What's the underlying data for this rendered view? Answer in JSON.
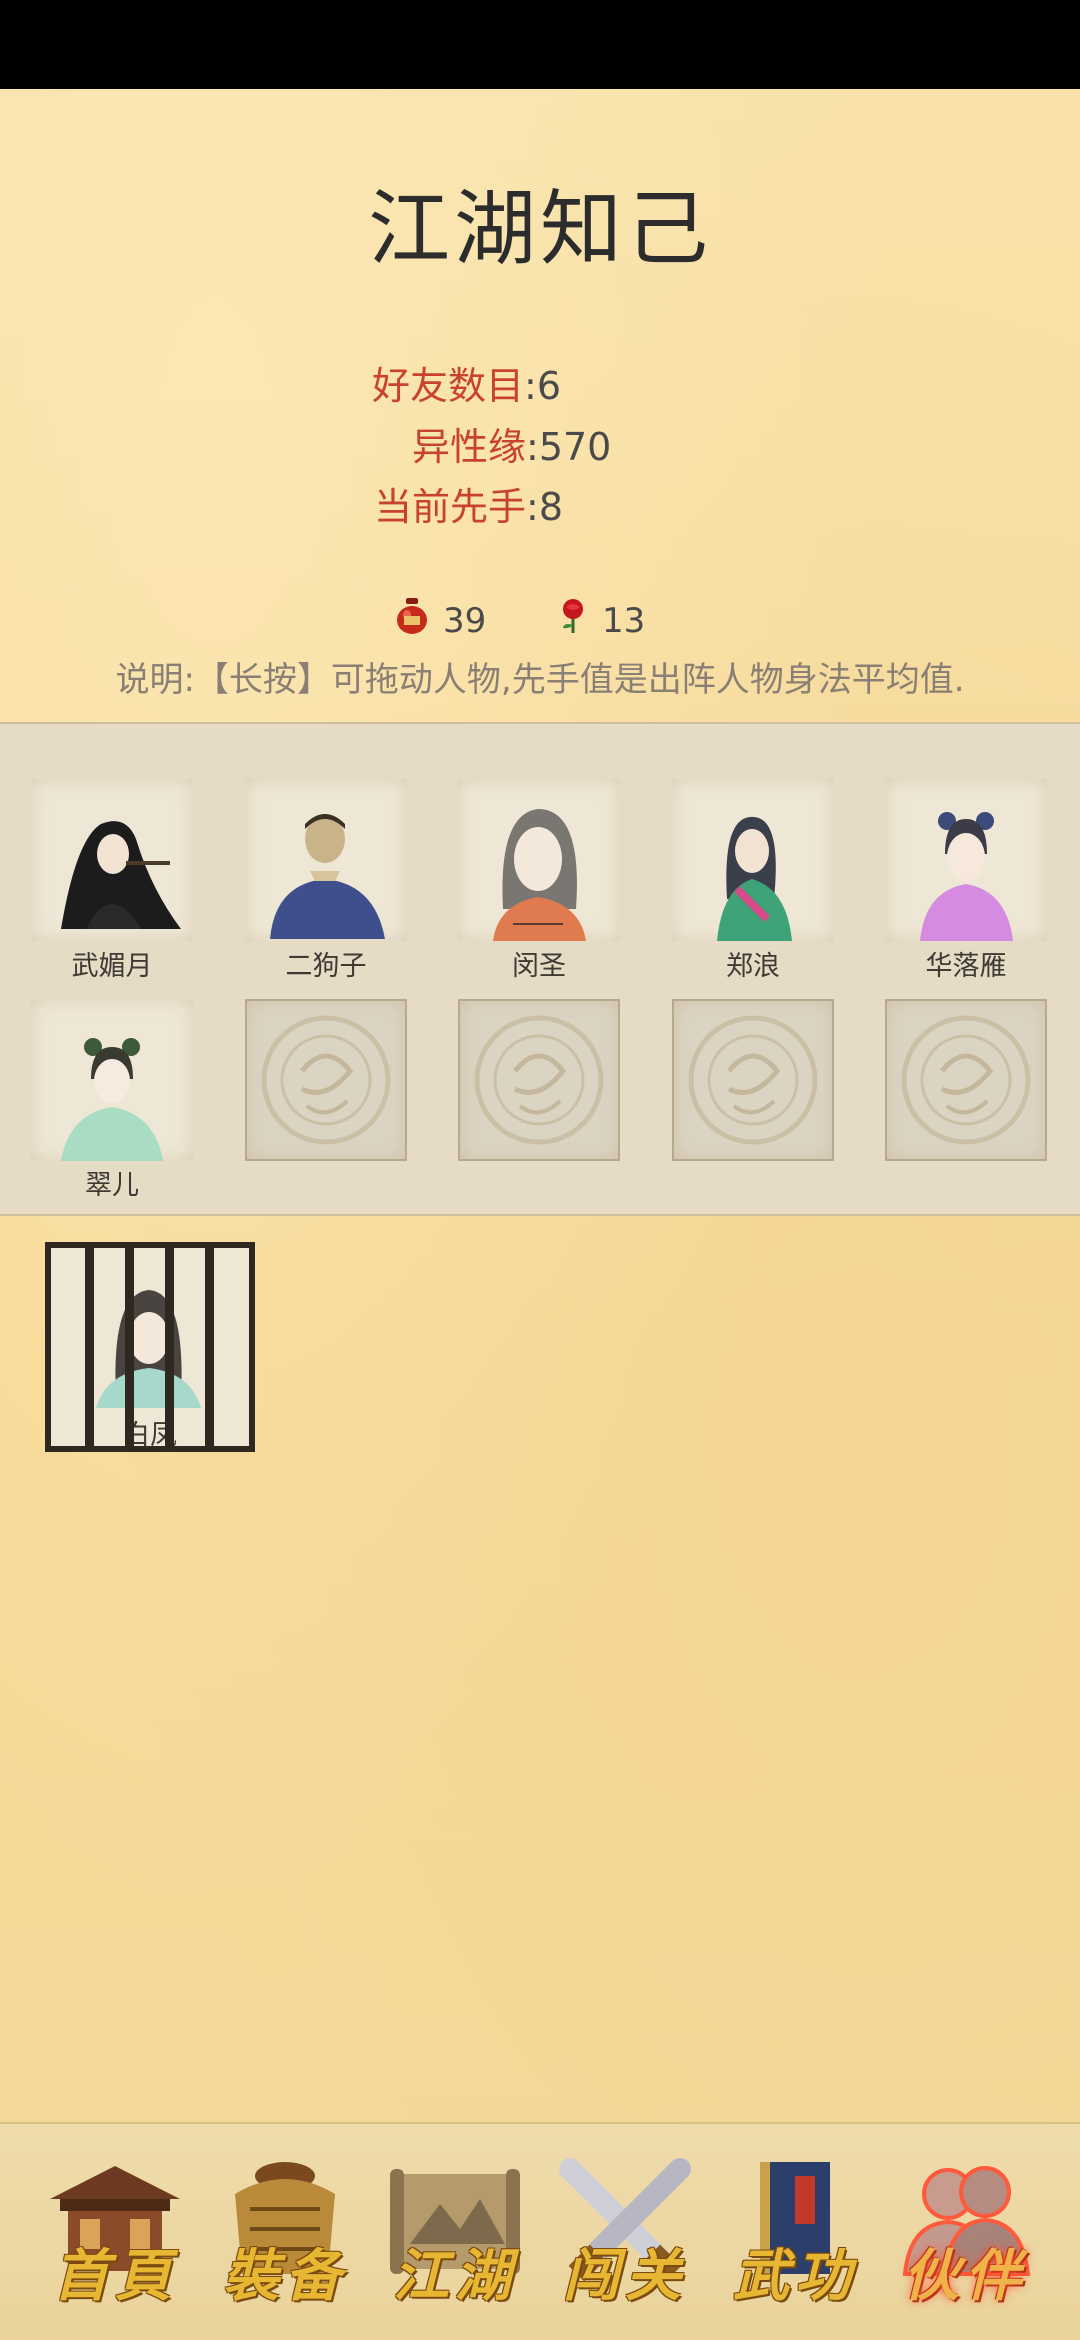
{
  "header": {
    "title": "江湖知己"
  },
  "stats": [
    {
      "label": "好友数目",
      "value": ":6"
    },
    {
      "label": "异性缘",
      "value": ":570"
    },
    {
      "label": "当前先手",
      "value": ":8"
    }
  ],
  "currencies": [
    {
      "icon": "wine-jar-icon",
      "value": "39"
    },
    {
      "icon": "rose-icon",
      "value": "13"
    }
  ],
  "description": "说明:【长按】可拖动人物,先手值是出阵人物身法平均值.",
  "roster": [
    {
      "name": "武媚月"
    },
    {
      "name": "二狗子"
    },
    {
      "name": "闵圣"
    },
    {
      "name": "郑浪"
    },
    {
      "name": "华落雁"
    },
    {
      "name": "翠儿"
    }
  ],
  "empty_slot_icon": "dragon-seal-icon",
  "caged": {
    "name": "白凤",
    "icon": "cage-icon"
  },
  "nav": [
    {
      "label": "首頁",
      "icon": "house-icon"
    },
    {
      "label": "裝备",
      "icon": "armor-icon"
    },
    {
      "label": "江湖",
      "icon": "scroll-map-icon"
    },
    {
      "label": "闯关",
      "icon": "crossed-swords-icon"
    },
    {
      "label": "武功",
      "icon": "martial-book-icon"
    },
    {
      "label": "伙伴",
      "icon": "companions-icon",
      "active": true
    }
  ],
  "colors": {
    "label_red": "#c8432c",
    "nav_gold": "#e7b734",
    "paper": "#f7dfa4",
    "panel": "#e6dcc6"
  }
}
